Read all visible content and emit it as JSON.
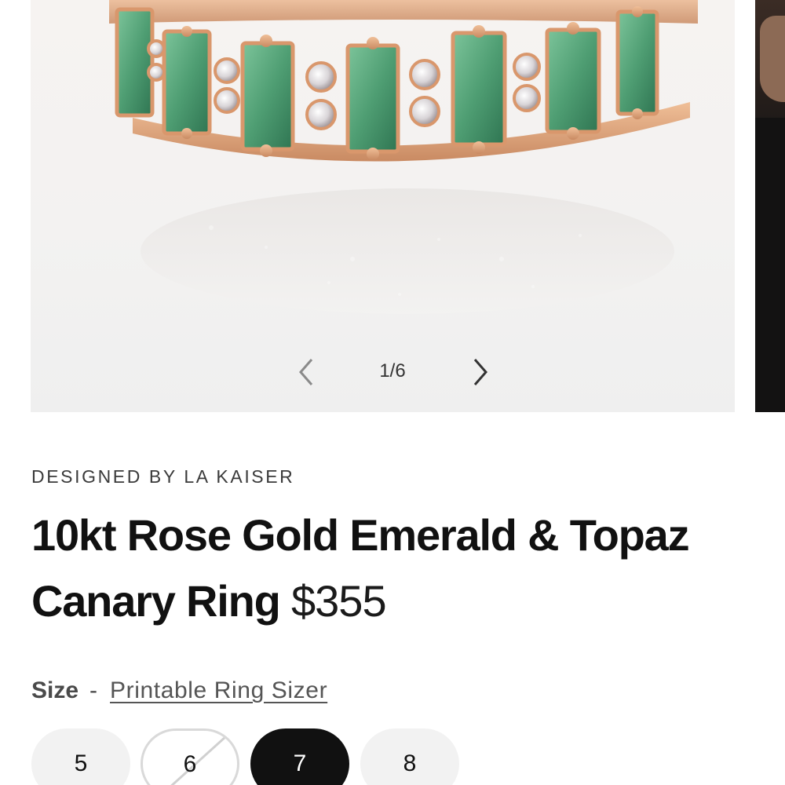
{
  "gallery": {
    "counter": "1/6",
    "prev_icon": "chevron-left-icon",
    "next_icon": "chevron-right-icon"
  },
  "product": {
    "designer": "DESIGNED BY LA KAISER",
    "title": "10kt Rose Gold Emerald & Topaz Canary Ring",
    "price": "$355"
  },
  "size": {
    "label": "Size",
    "separator": "-",
    "sizer_link": "Printable Ring Sizer",
    "options": [
      {
        "label": "5",
        "state": "available"
      },
      {
        "label": "6",
        "state": "unavailable"
      },
      {
        "label": "7",
        "state": "selected"
      },
      {
        "label": "8",
        "state": "available"
      }
    ]
  },
  "colors": {
    "emerald": "#4f9e73",
    "rose_gold": "#e0a27a",
    "topaz": "#d8d4d6",
    "selected_bg": "#111111",
    "pill_bg": "#f2f2f2"
  }
}
